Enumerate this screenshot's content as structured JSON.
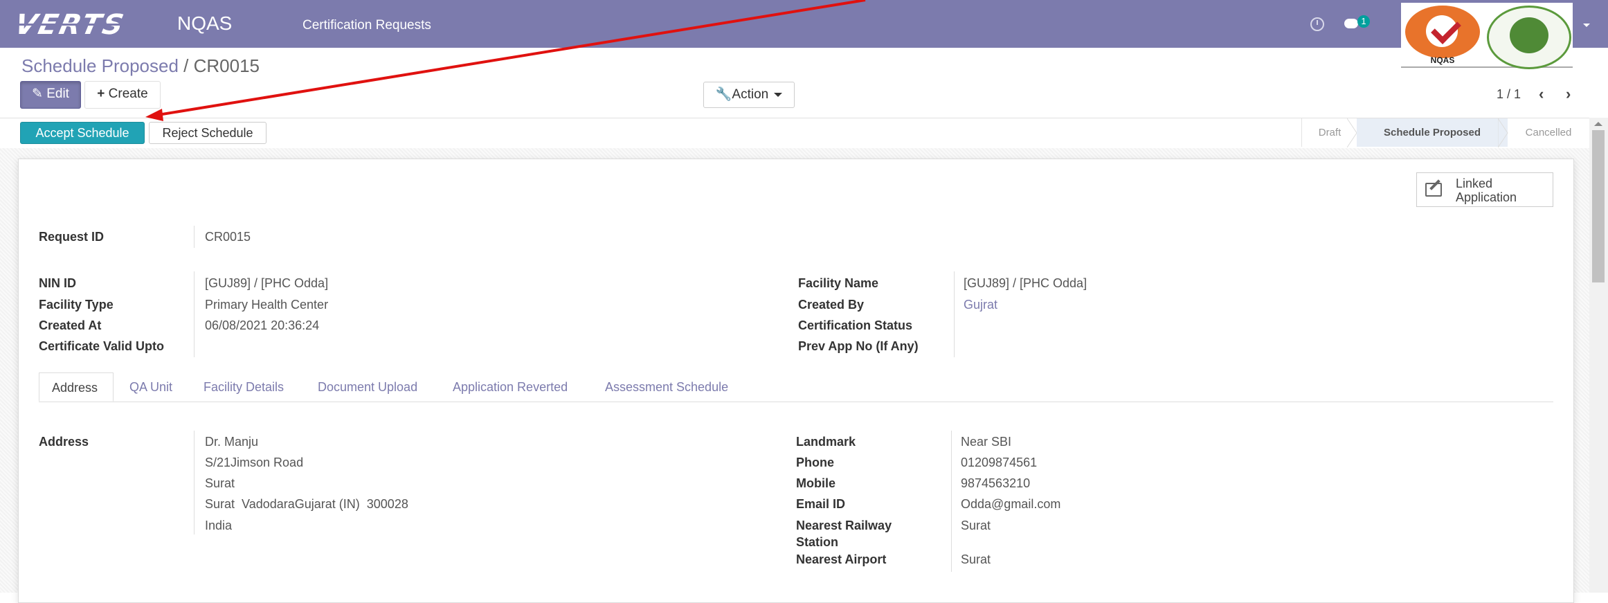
{
  "navbar": {
    "logo_text": "VERTS",
    "app_name": "NQAS",
    "menu_item": "Certification Requests",
    "chat_badge": "1",
    "logo_caption": "NQAS"
  },
  "breadcrumb": {
    "parent": "Schedule Proposed",
    "separator": " / ",
    "current": "CR0015"
  },
  "toolbar": {
    "edit_label": "Edit",
    "create_label": "Create",
    "action_label": "Action",
    "pager": "1 / 1"
  },
  "statusbar": {
    "accept_label": "Accept Schedule",
    "reject_label": "Reject Schedule",
    "stages": [
      "Draft",
      "Schedule Proposed",
      "Cancelled"
    ],
    "active_stage": "Schedule Proposed"
  },
  "linked_button": {
    "line1": "Linked",
    "line2": "Application"
  },
  "form": {
    "request_id_label": "Request ID",
    "request_id": "CR0015",
    "nin_id_label": "NIN ID",
    "nin_id": "[GUJ89] / [PHC Odda]",
    "facility_type_label": "Facility Type",
    "facility_type": "Primary Health Center",
    "created_at_label": "Created At",
    "created_at": "06/08/2021 20:36:24",
    "cert_valid_label": "Certificate Valid Upto",
    "cert_valid": "",
    "facility_name_label": "Facility Name",
    "facility_name": "[GUJ89] / [PHC Odda]",
    "created_by_label": "Created By",
    "created_by": "Gujrat",
    "cert_status_label": "Certification Status",
    "cert_status": "",
    "prev_app_label": "Prev App No (If Any)",
    "prev_app": ""
  },
  "tabs": [
    "Address",
    "QA Unit",
    "Facility Details",
    "Document Upload",
    "Application Reverted",
    "Assessment Schedule"
  ],
  "address": {
    "label": "Address",
    "line1": "Dr. Manju",
    "line2": "S/21Jimson Road",
    "line3": "Surat",
    "line4": "Surat  VadodaraGujarat (IN)  300028",
    "line5": "India",
    "landmark_label": "Landmark",
    "landmark": "Near SBI",
    "phone_label": "Phone",
    "phone": "01209874561",
    "mobile_label": "Mobile",
    "mobile": "9874563210",
    "email_label": "Email ID",
    "email": "Odda@gmail.com",
    "railway_label_1": "Nearest Railway",
    "railway_label_2": "Station",
    "railway": "Surat",
    "airport_label": "Nearest Airport",
    "airport": "Surat"
  },
  "colors": {
    "navbar": "#7c7bad",
    "accept_button": "#21a3b5",
    "annotation_arrow": "#e0110f"
  }
}
